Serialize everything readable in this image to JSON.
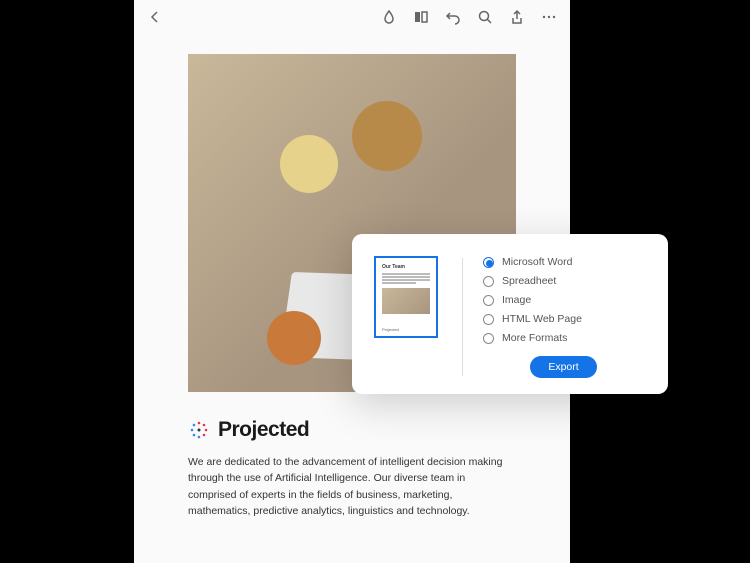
{
  "toolbar": {
    "icons": [
      "back",
      "water-drop",
      "panel",
      "undo",
      "search",
      "share",
      "more"
    ]
  },
  "document": {
    "logo_text": "Projected",
    "body_text": "We are dedicated to the advancement of intelligent decision making through the use of Artificial Intelligence. Our diverse team in comprised of experts in the fields of business,  marketing, mathematics, predictive analytics, linguistics and technology.",
    "thumb_title": "Our Team",
    "thumb_logo": "Projected"
  },
  "export_panel": {
    "options": [
      {
        "label": "Microsoft Word",
        "selected": true
      },
      {
        "label": "Spreadheet",
        "selected": false
      },
      {
        "label": "Image",
        "selected": false
      },
      {
        "label": "HTML Web Page",
        "selected": false
      },
      {
        "label": "More Formats",
        "selected": false
      }
    ],
    "button_label": "Export"
  }
}
